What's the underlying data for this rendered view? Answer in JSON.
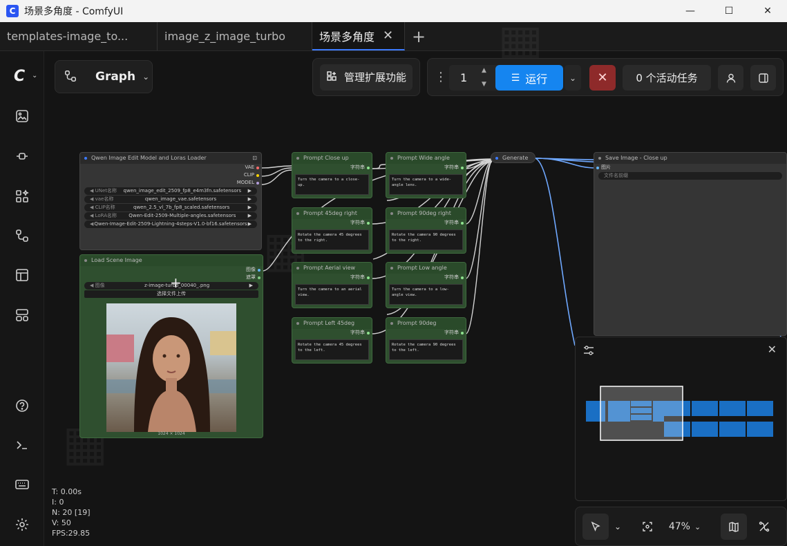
{
  "window": {
    "title": "场景多角度 - ComfyUI",
    "app_icon": "C"
  },
  "tabs": [
    {
      "label": "templates-image_to..."
    },
    {
      "label": "image_z_image_turbo"
    },
    {
      "label": "场景多角度"
    }
  ],
  "toolbar": {
    "graph_label": "Graph",
    "manage_extensions": "管理扩展功能",
    "run_count": "1",
    "run_label": "运行",
    "active_jobs": "0 个活动任务"
  },
  "nodes": {
    "loader": {
      "title": "Qwen Image Edit Model and Loras Loader",
      "outputs": [
        "VAE",
        "CLIP",
        "MODEL"
      ],
      "widgets": [
        {
          "name": "UNet名称",
          "value": "qwen_image_edit_2509_fp8_e4m3fn.safetensors"
        },
        {
          "name": "vae名称",
          "value": "qwen_image_vae.safetensors"
        },
        {
          "name": "CLIP名称",
          "value": "qwen_2.5_vl_7b_fp8_scaled.safetensors"
        },
        {
          "name": "LoRA名称",
          "value": "Qwen-Edit-2509-Multiple-angles.safetensors"
        },
        {
          "name": "",
          "value": "Qwen-Image-Edit-2509-Lightning-4steps-V1.0-bf16.safetensors"
        }
      ]
    },
    "load_image": {
      "title": "Load Scene Image",
      "outputs": [
        "图像",
        "遮罩"
      ],
      "image_widget_name": "图像",
      "image_widget_value": "z-image-turbo_00040_.png",
      "upload_label": "选择文件上传",
      "size_label": "1024 × 1024"
    },
    "prompts": [
      {
        "title": "Prompt Close up",
        "out": "字符串",
        "text": "Turn the camera to a close-up."
      },
      {
        "title": "Prompt Wide angle",
        "out": "字符串",
        "text": "Turn the camera to a wide-angle lens."
      },
      {
        "title": "Prompt 45deg right",
        "out": "字符串",
        "text": "Rotate the camera 45 degrees to the right."
      },
      {
        "title": "Prompt 90deg right",
        "out": "字符串",
        "text": "Rotate the camera 90 degrees to the right."
      },
      {
        "title": "Prompt Aerial view",
        "out": "字符串",
        "text": "Turn the camera to an aerial view."
      },
      {
        "title": "Prompt Low angle",
        "out": "字符串",
        "text": "Turn the camera to a low-angle view."
      },
      {
        "title": "Prompt Left 45deg",
        "out": "字符串",
        "text": "Rotate the camera 45 degrees to the left."
      },
      {
        "title": "Prompt 90deg",
        "out": "字符串",
        "text": "Rotate the camera 90 degrees to the left."
      }
    ],
    "generate": {
      "title": "Generate"
    },
    "save": {
      "title": "Save Image - Close up",
      "input": "图片",
      "widget": "文件名前缀"
    }
  },
  "stats": {
    "t": "T: 0.00s",
    "i": "I: 0",
    "n": "N: 20 [19]",
    "v": "V: 50",
    "fps": "FPS:29.85"
  },
  "bottom": {
    "zoom": "47%"
  },
  "colors": {
    "accent": "#1585f0",
    "stop": "#8e2a2a",
    "node_green": "#2f4f2f",
    "link_blue": "#6fa8ff"
  }
}
